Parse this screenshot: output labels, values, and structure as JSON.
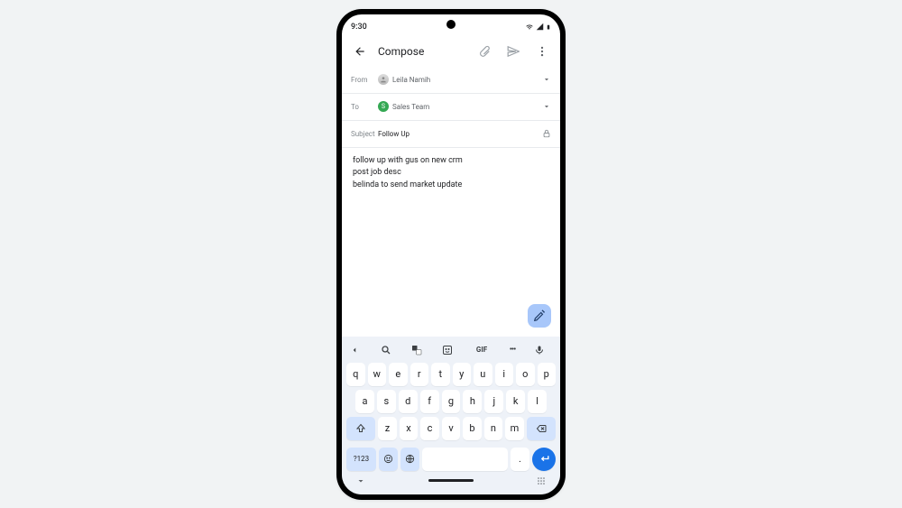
{
  "status": {
    "time": "9:30"
  },
  "header": {
    "title": "Compose"
  },
  "from": {
    "label": "From",
    "name": "Leila Namih"
  },
  "to": {
    "label": "To",
    "name": "Sales Team",
    "initial": "S"
  },
  "subject": {
    "label": "Subject",
    "value": "Follow Up"
  },
  "body": {
    "line1": "follow up with gus on new crm",
    "line2": "post job desc",
    "line3": "belinda to send market update"
  },
  "kb": {
    "gif": "GIF",
    "dots": "•••",
    "r1": [
      "q",
      "w",
      "e",
      "r",
      "t",
      "y",
      "u",
      "i",
      "o",
      "p"
    ],
    "r2": [
      "a",
      "s",
      "d",
      "f",
      "g",
      "h",
      "j",
      "k",
      "l"
    ],
    "r3": [
      "z",
      "x",
      "c",
      "v",
      "b",
      "n",
      "m"
    ],
    "sym": "?123",
    "period": "."
  }
}
